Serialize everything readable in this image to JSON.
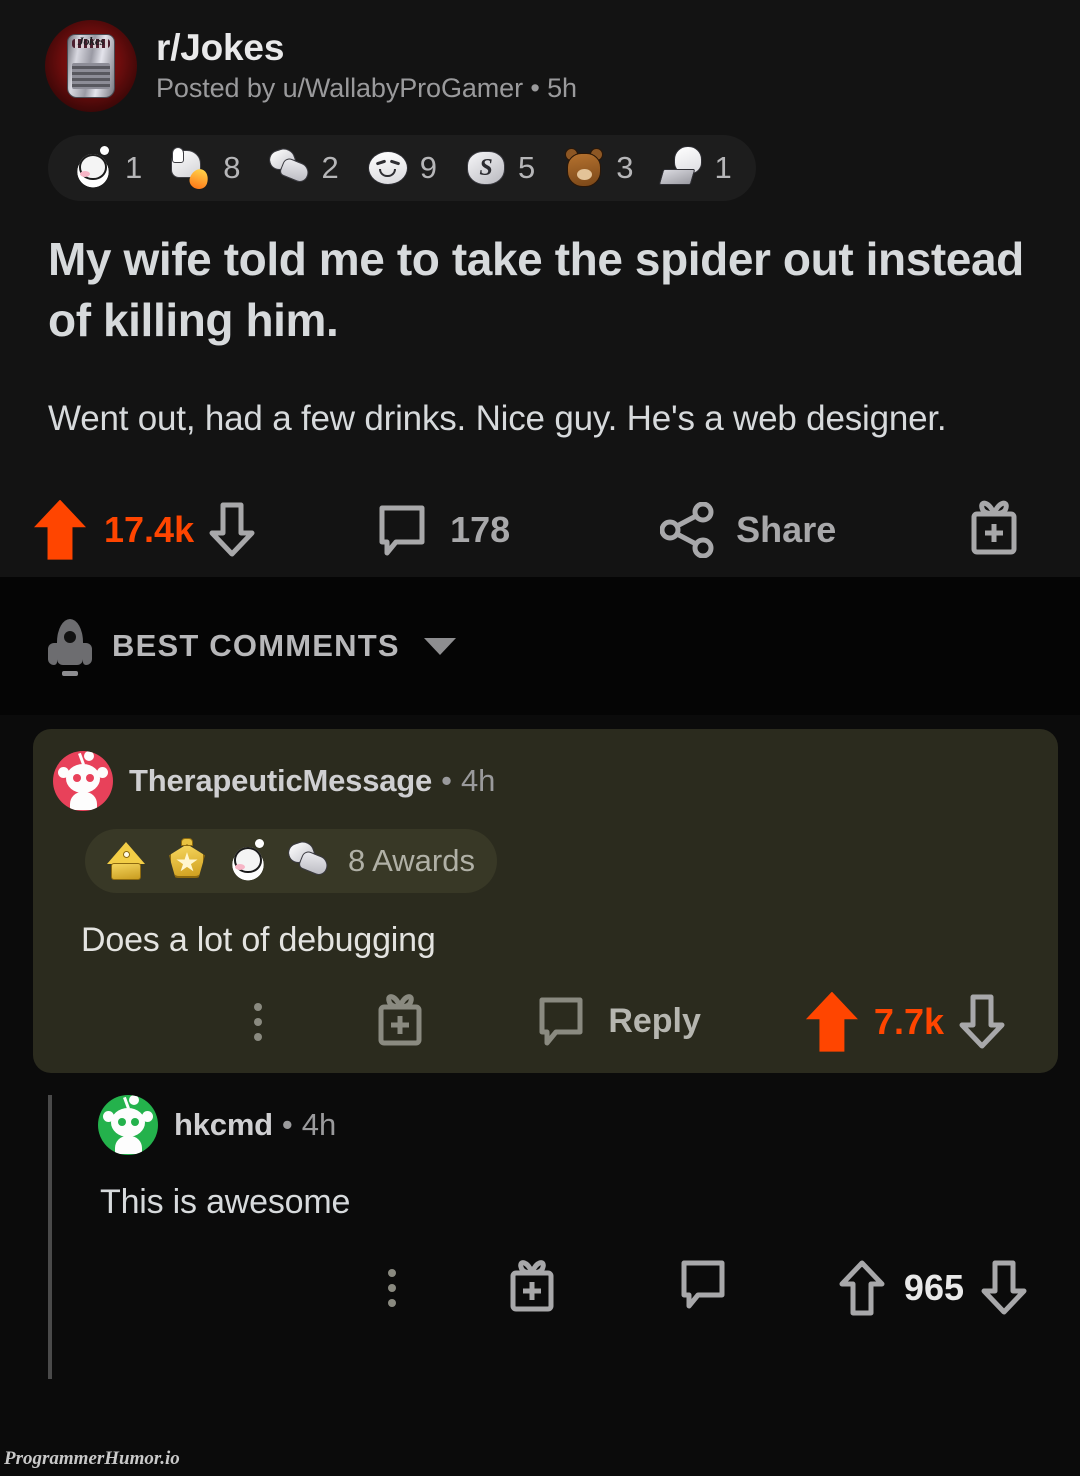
{
  "post": {
    "subreddit": "r/Jokes",
    "meta": "Posted by u/WallabyProGamer • 5h",
    "subreddit_avatar_label": "Jokes",
    "title": "My wife told me to take the spider out instead of killing him.",
    "body": "Went out, had a few drinks. Nice guy. He's a web designer.",
    "awards": [
      {
        "name": "snoo-wink-award",
        "count": "1"
      },
      {
        "name": "thumbs-up-flame-award",
        "count": "8"
      },
      {
        "name": "handshake-award",
        "count": "2"
      },
      {
        "name": "smiling-face-award",
        "count": "9"
      },
      {
        "name": "silver-award",
        "count": "5"
      },
      {
        "name": "bear-hug-award",
        "count": "3"
      },
      {
        "name": "snoo-laptop-award",
        "count": "1"
      }
    ],
    "actions": {
      "upvote_icon": "arrow-up-filled-icon",
      "score": "17.4k",
      "downvote_icon": "arrow-down-outline-icon",
      "comment_icon": "comment-bubble-icon",
      "comment_count": "178",
      "share_icon": "share-icon",
      "share_label": "Share",
      "award_icon": "gift-award-icon"
    }
  },
  "sort_bar": {
    "icon": "rocket-icon",
    "label": "BEST COMMENTS",
    "chevron": "chevron-down-icon"
  },
  "comments": [
    {
      "author": "TherapeuticMessage",
      "separator": "•",
      "time": "4h",
      "avatar": "snoo-avatar-red",
      "awards_icons": [
        "gold-pyramid-award",
        "gold-star-award",
        "snoo-wink-award",
        "handshake-award"
      ],
      "awards_text": "8 Awards",
      "body": "Does a lot of debugging",
      "actions": {
        "overflow_icon": "overflow-dots-icon",
        "award_icon": "gift-award-icon",
        "reply_icon": "comment-bubble-icon",
        "reply_label": "Reply",
        "upvote_icon": "arrow-up-filled-icon",
        "score": "7.7k",
        "downvote_icon": "arrow-down-outline-icon"
      }
    }
  ],
  "reply": {
    "author": "hkcmd",
    "separator": "•",
    "time": "4h",
    "avatar": "snoo-avatar-green",
    "body": "This is awesome",
    "actions": {
      "overflow_icon": "overflow-dots-icon",
      "award_icon": "gift-award-icon",
      "reply_icon": "comment-bubble-icon",
      "upvote_icon": "arrow-up-outline-icon",
      "score": "965",
      "downvote_icon": "arrow-down-outline-icon"
    }
  },
  "watermark": "ProgrammerHumor.io",
  "colors": {
    "upvote_orange": "#ff4500",
    "page_bg": "#0b0b0b",
    "post_bg": "#131313",
    "sortbar_bg": "#050505",
    "comment_card_bg": "#2b2b1e",
    "text_primary": "#d7dadc",
    "text_muted": "#9a9a9c"
  }
}
